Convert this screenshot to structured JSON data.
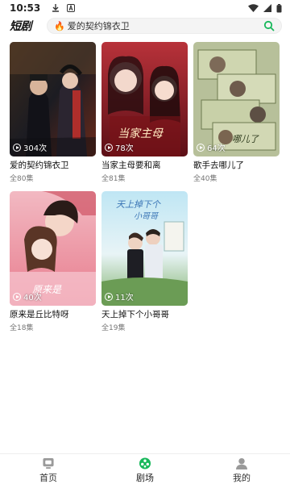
{
  "status_bar": {
    "time": "10:53",
    "left_icons": [
      "download-icon",
      "notification-a-icon"
    ],
    "right_icons": [
      "wifi-icon",
      "signal-icon",
      "battery-icon"
    ]
  },
  "header": {
    "logo": "短剧",
    "search_text": "爱的契约锦衣卫",
    "search_icon": "search-icon",
    "accent_color": "#18b85b"
  },
  "dramas": [
    {
      "title": "爱的契约锦衣卫",
      "plays": "304次",
      "episodes": "全80集"
    },
    {
      "title": "当家主母要和离",
      "plays": "78次",
      "episodes": "全81集"
    },
    {
      "title": "歌手去哪儿了",
      "plays": "64次",
      "episodes": "全40集"
    },
    {
      "title": "原来是丘比特呀",
      "plays": "40次",
      "episodes": "全18集"
    },
    {
      "title": "天上掉下个小哥哥",
      "plays": "11次",
      "episodes": "全19集"
    }
  ],
  "bottom_nav": [
    {
      "label": "首页",
      "icon": "tv-icon",
      "active": false
    },
    {
      "label": "剧场",
      "icon": "film-reel-icon",
      "active": true
    },
    {
      "label": "我的",
      "icon": "user-icon",
      "active": false
    }
  ]
}
